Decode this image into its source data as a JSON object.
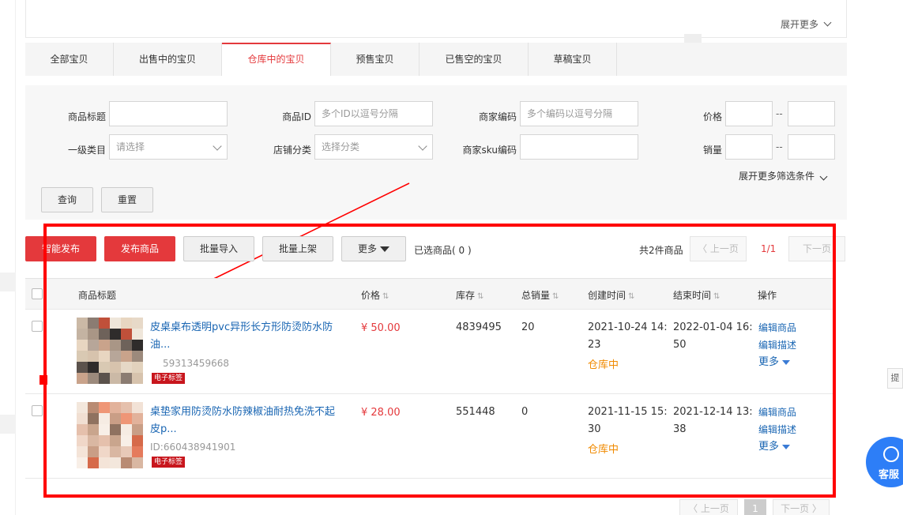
{
  "header": {
    "expand_more": "展开更多"
  },
  "tabs": [
    {
      "label": "全部宝贝"
    },
    {
      "label": "出售中的宝贝"
    },
    {
      "label": "仓库中的宝贝"
    },
    {
      "label": "预售宝贝"
    },
    {
      "label": "已售空的宝贝"
    },
    {
      "label": "草稿宝贝"
    }
  ],
  "active_tab": "仓库中的宝贝",
  "filters": {
    "title_label": "商品标题",
    "id_label": "商品ID",
    "id_placeholder": "多个ID以逗号分隔",
    "merchant_code_label": "商家编码",
    "merchant_code_placeholder": "多个编码以逗号分隔",
    "price_label": "价格",
    "category_label": "一级类目",
    "category_placeholder": "请选择",
    "shop_category_label": "店铺分类",
    "shop_category_placeholder": "选择分类",
    "sku_code_label": "商家sku编码",
    "sales_label": "销量",
    "range_sep": "--",
    "expand_more_filters": "展开更多筛选条件",
    "query_button": "查询",
    "reset_button": "重置"
  },
  "toolbar": {
    "smart_publish": "智能发布",
    "publish": "发布商品",
    "batch_import": "批量导入",
    "batch_list": "批量上架",
    "more": "更多",
    "selected": "已选商品( 0 )",
    "total": "共2件商品",
    "prev": "上一页",
    "page_info": "1/1",
    "next": "下一页"
  },
  "table": {
    "headers": {
      "title": "商品标题",
      "price": "价格",
      "stock": "库存",
      "sales": "总销量",
      "created": "创建时间",
      "ended": "结束时间",
      "actions": "操作"
    },
    "rows": [
      {
        "title_line1": "皮桌桌布透明pvc异形长方形防烫防水防",
        "title_line2": "油...",
        "id": "59313459668",
        "tag": "电子标签",
        "price": "¥ 50.00",
        "stock": "4839495",
        "sales": "20",
        "created_line1": "2021-10-24 14:",
        "created_line2": "23",
        "status": "仓库中",
        "ended_line1": "2022-01-04 16:",
        "ended_line2": "50",
        "op_edit": "编辑商品",
        "op_desc": "编辑描述",
        "op_more": "更多"
      },
      {
        "title_line1": "桌垫家用防烫防水防辣椒油耐热免洗不起",
        "title_line2": "皮p...",
        "id": "ID:660438941901",
        "tag": "电子标签",
        "price": "¥ 28.00",
        "stock": "551448",
        "sales": "0",
        "created_line1": "2021-11-15 15:",
        "created_line2": "30",
        "status": "仓库中",
        "ended_line1": "2021-12-14 13:",
        "ended_line2": "38",
        "op_edit": "编辑商品",
        "op_desc": "编辑描述",
        "op_more": "更多"
      }
    ]
  },
  "bottom_pager": {
    "prev": "上一页",
    "page": "1",
    "next": "下一页"
  },
  "side": {
    "feedback_char": "提",
    "service_label": "客服",
    "service_icon": "headset-icon"
  },
  "colors": {
    "accent_red": "#e4393c",
    "link_blue": "#1a66b3",
    "status_orange": "#f08a00",
    "annotation_red": "#ff0000",
    "service_blue": "#2d7ef7"
  }
}
